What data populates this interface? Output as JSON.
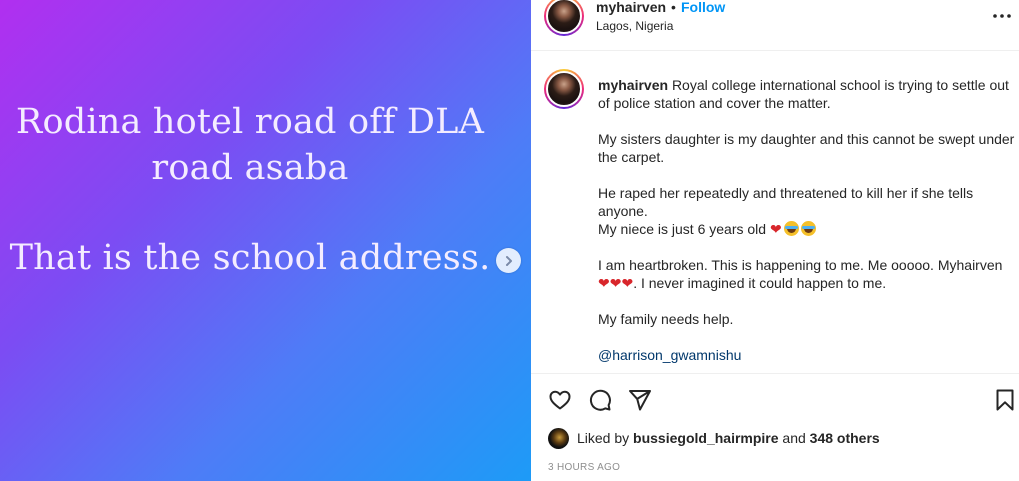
{
  "media": {
    "lines": [
      "Rodina hotel road off DLA",
      "road asaba",
      "That is the school address."
    ],
    "gradient_colors": [
      "#b12ff0",
      "#7c4cf3",
      "#4e7cf7",
      "#1d9bf7"
    ],
    "next_icon": "chevron-right-icon"
  },
  "header": {
    "username": "myhairven",
    "dot": "•",
    "follow_label": "Follow",
    "location": "Lagos, Nigeria",
    "more_icon": "more-horizontal-icon"
  },
  "caption": {
    "username": "myhairven",
    "paragraphs": [
      "Royal college international school is trying to settle out of police station and cover the matter.",
      "My sisters daughter is my daughter and this cannot be swept under the carpet.",
      "He raped her repeatedly and threatened to kill her if she tells anyone.",
      "My niece is just 6 years old",
      "I am heartbroken. This is happening to me. Me ooooo. Myhairven",
      ". I never imagined it could happen to me.",
      "My family needs help."
    ],
    "heart_emoji": "❤",
    "mention": "@harrison_gwamnishu"
  },
  "actions": {
    "like_icon": "heart-icon",
    "comment_icon": "comment-icon",
    "share_icon": "send-icon",
    "save_icon": "bookmark-icon"
  },
  "likes": {
    "prefix": "Liked by",
    "user": "bussiegold_hairmpire",
    "and": "and",
    "count": "348 others"
  },
  "timestamp": "3 HOURS AGO",
  "colors": {
    "accent": "#0095f6",
    "mention": "#00376b",
    "muted": "#8e8e8e",
    "heart": "#d8262b"
  }
}
